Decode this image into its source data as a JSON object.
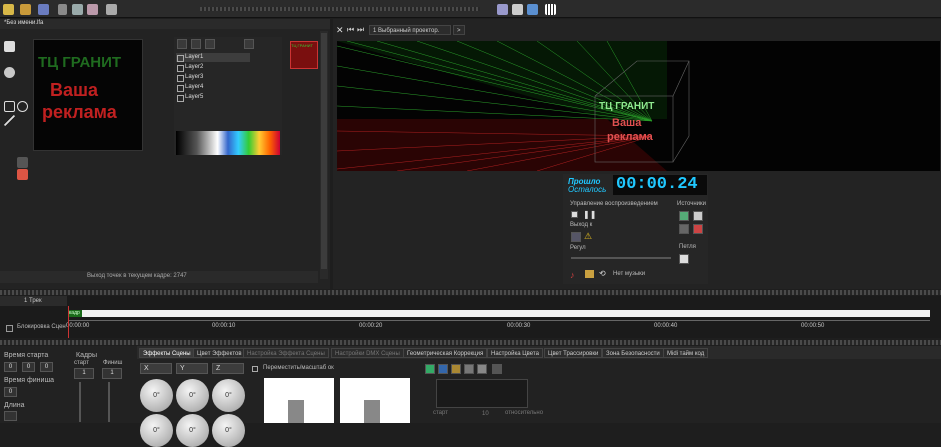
{
  "window": {
    "title": "*Без имени.lfa"
  },
  "colors": {
    "accent_red": "#e03030",
    "accent_green": "#36c236",
    "time_cyan": "#20c8ff"
  },
  "toolbar": {
    "icons": [
      "new-icon",
      "open-icon",
      "save-icon",
      "cut-icon",
      "copy-icon",
      "paste-icon",
      "settings-icon",
      "align-icon",
      "grid-icon",
      "monitor-icon",
      "piano-icon"
    ]
  },
  "editor": {
    "preview_text_line1": "ТЦ ГРАНИТ",
    "preview_text_line2": "Ваша",
    "preview_text_line3": "реклама",
    "thumbnail_text": "ТЦ ГРАНИТ",
    "layers": [
      "Layer1",
      "Layer2",
      "Layer3",
      "Layer4",
      "Layer5"
    ],
    "status": "Выход точек в текущем кадре: 2747"
  },
  "projector": {
    "tab_label": "1 Выбранный проектор.",
    "add_tab": ">",
    "scene_text_line1": "ТЦ ГРАНИТ",
    "scene_text_line2": "Ваша",
    "scene_text_line3": "реклама"
  },
  "playback": {
    "passed_label": "Прошло",
    "remaining_label": "Осталось",
    "time": "00:00.24",
    "control_label": "Управление воспроизведением",
    "sources_label": "Источники",
    "output_label": "Выход к",
    "speed_label": "Регул",
    "loop_label": "Петля",
    "music_label": "Нет музыки"
  },
  "timeline": {
    "track_label": "1 Трек",
    "lock_label": "Блокировка Сцен",
    "clip_label": "кадр",
    "ticks": [
      "00:00:00",
      "00:00:10",
      "00:00:20",
      "00:00:30",
      "00:00:40",
      "00:00:50"
    ]
  },
  "bottom": {
    "start_time_label": "Время старта",
    "end_time_label": "Время финиша",
    "length_label": "Длина",
    "frames_label": "Кадры",
    "start_sub_label": "старт",
    "finish_sub_label": "Финиш",
    "start_frame_value": "1",
    "finish_frame_value": "1",
    "spin_values": [
      "0",
      "0",
      "0",
      "0"
    ],
    "tabs": [
      "Эффекты Сцены",
      "Цвет Эффектов",
      "Настройка Эффекта Сцены",
      "Настройки DMX Сцены",
      "Геометрическая Коррекция",
      "Настройка Цвета",
      "Цвет Трассировки",
      "Зона Безопасности",
      "Midi тайм код"
    ],
    "axis_labels": [
      "X",
      "Y",
      "Z"
    ],
    "knob_values": [
      "0°",
      "0°",
      "0°",
      "0°",
      "0°",
      "0°"
    ],
    "move_scale_label": "Переместить/масштаб ок",
    "start_label": "старт",
    "relative_label": "относительно",
    "value_10": "10"
  }
}
